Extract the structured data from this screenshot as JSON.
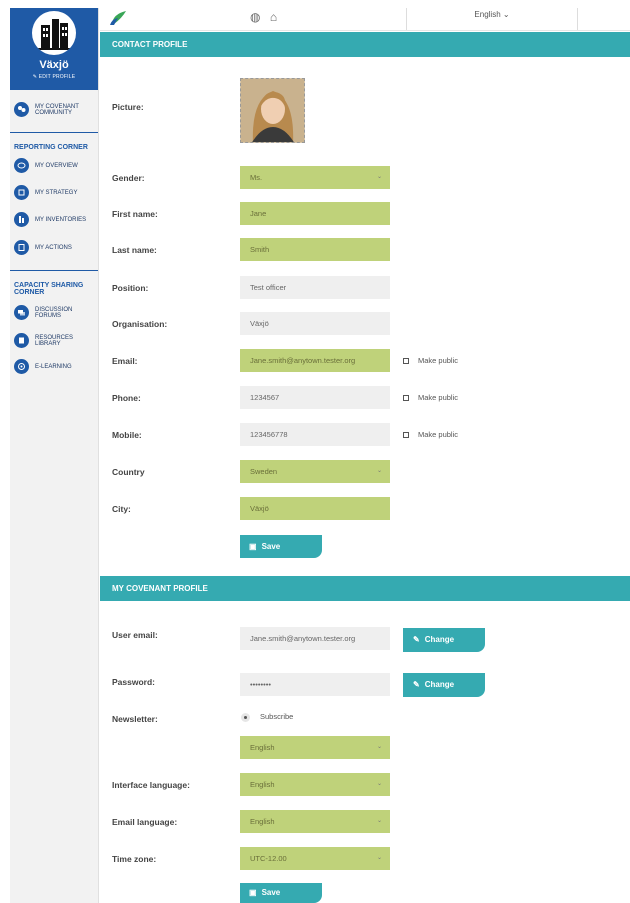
{
  "sidebar": {
    "city_name": "Växjö",
    "edit_profile": "EDIT PROFILE",
    "community": "MY COVENANT COMMUNITY",
    "reporting_heading": "REPORTING CORNER",
    "reporting_items": [
      "MY OVERVIEW",
      "MY STRATEGY",
      "MY INVENTORIES",
      "MY ACTIONS"
    ],
    "capacity_heading": "CAPACITY SHARING CORNER",
    "capacity_items": [
      "DISCUSSION FORUMS",
      "RESOURCES LIBRARY",
      "E-LEARNING"
    ]
  },
  "topbar": {
    "language": "English"
  },
  "contact": {
    "section_title": "CONTACT PROFILE",
    "picture_label": "Picture:",
    "gender_label": "Gender:",
    "gender_value": "Ms.",
    "first_name_label": "First name:",
    "first_name_value": "Jane",
    "last_name_label": "Last name:",
    "last_name_value": "Smith",
    "position_label": "Position:",
    "position_value": "Test officer",
    "organisation_label": "Organisation:",
    "organisation_value": "Växjö",
    "email_label": "Email:",
    "email_value": "Jane.smith@anytown.tester.org",
    "phone_label": "Phone:",
    "phone_value": "1234567",
    "mobile_label": "Mobile:",
    "mobile_value": "123456778",
    "country_label": "Country",
    "country_value": "Sweden",
    "city_label": "City:",
    "city_value": "Växjö",
    "make_public": "Make public",
    "save_label": "Save"
  },
  "covenant": {
    "section_title": "MY COVENANT PROFILE",
    "user_email_label": "User email:",
    "user_email_value": "Jane.smith@anytown.tester.org",
    "password_label": "Password:",
    "password_value": "••••••••",
    "change_label": "Change",
    "newsletter_label": "Newsletter:",
    "subscribe_label": "Subscribe",
    "newsletter_language": "English",
    "interface_language_label": "Interface language:",
    "interface_language_value": "English",
    "email_language_label": "Email language:",
    "email_language_value": "English",
    "time_zone_label": "Time zone:",
    "time_zone_value": "UTC-12.00",
    "save_label": "Save"
  },
  "colors": {
    "sidebar_blue": "#1f5aa6",
    "teal": "#35aab1",
    "field_green": "#bfd27a",
    "field_grey": "#efefef"
  }
}
